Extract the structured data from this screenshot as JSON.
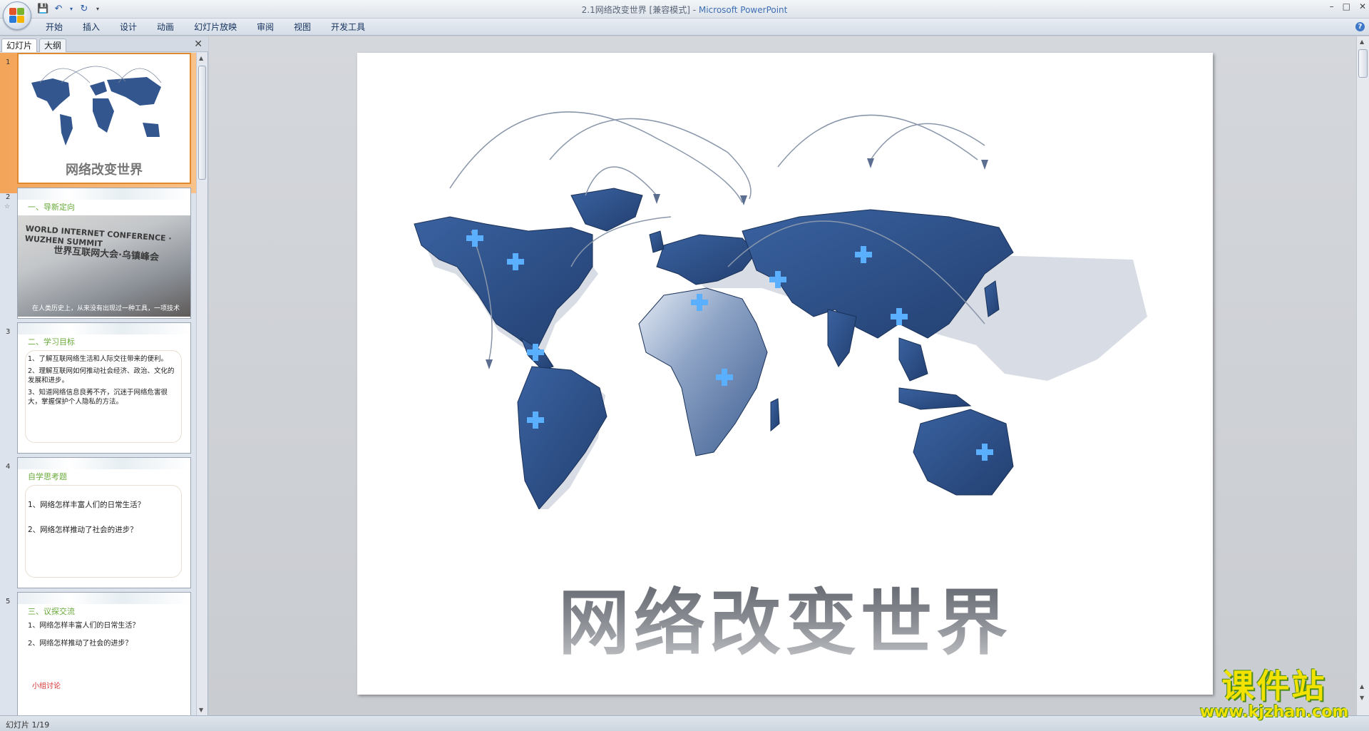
{
  "window": {
    "title": "2.1网络改变世界 [兼容模式]",
    "separator": " - ",
    "app_name": "Microsoft PowerPoint"
  },
  "ribbon": {
    "tabs": [
      "开始",
      "插入",
      "设计",
      "动画",
      "幻灯片放映",
      "审阅",
      "视图",
      "开发工具"
    ]
  },
  "left_pane": {
    "tabs": [
      "幻灯片",
      "大纲"
    ],
    "active_tab": "幻灯片"
  },
  "thumbnails": {
    "numbers": [
      "1",
      "2",
      "3",
      "4",
      "5"
    ],
    "s1": {
      "title": "网络改变世界"
    },
    "s2": {
      "heading": "一、导新定向",
      "photo_text_en": "WORLD INTERNET CONFERENCE · WUZHEN SUMMIT",
      "photo_text_zh": "世界互联网大会·乌镇峰会",
      "caption": "在人类历史上，从来没有出现过一种工具，一项技术"
    },
    "s3": {
      "heading": "二、学习目标",
      "items": [
        "1、了解互联网络生活和人际交往带来的便利。",
        "2、理解互联网如何推动社会经济、政治、文化的发展和进步。",
        "3、知道网络信息良莠不齐，沉迷于网络危害很大，掌握保护个人隐私的方法。"
      ]
    },
    "s4": {
      "heading": "自学思考题",
      "items": [
        "1、网络怎样丰富人们的日常生活？",
        "2、网络怎样推动了社会的进步？"
      ]
    },
    "s5": {
      "heading": "三、议探交流",
      "items": [
        "1、网络怎样丰富人们的日常生活？",
        "2、网络怎样推动了社会的进步？"
      ],
      "footer": "小组讨论"
    }
  },
  "slide": {
    "title": "网络改变世界"
  },
  "status": {
    "slide_indicator": "幻灯片 1/19"
  },
  "watermark": {
    "line1": "课件站",
    "line2": "www.kjzhan.com"
  },
  "colors": {
    "accent_orange": "#f3a559",
    "heading_green": "#6aaa3a",
    "map_blue": "#2b4f86"
  }
}
